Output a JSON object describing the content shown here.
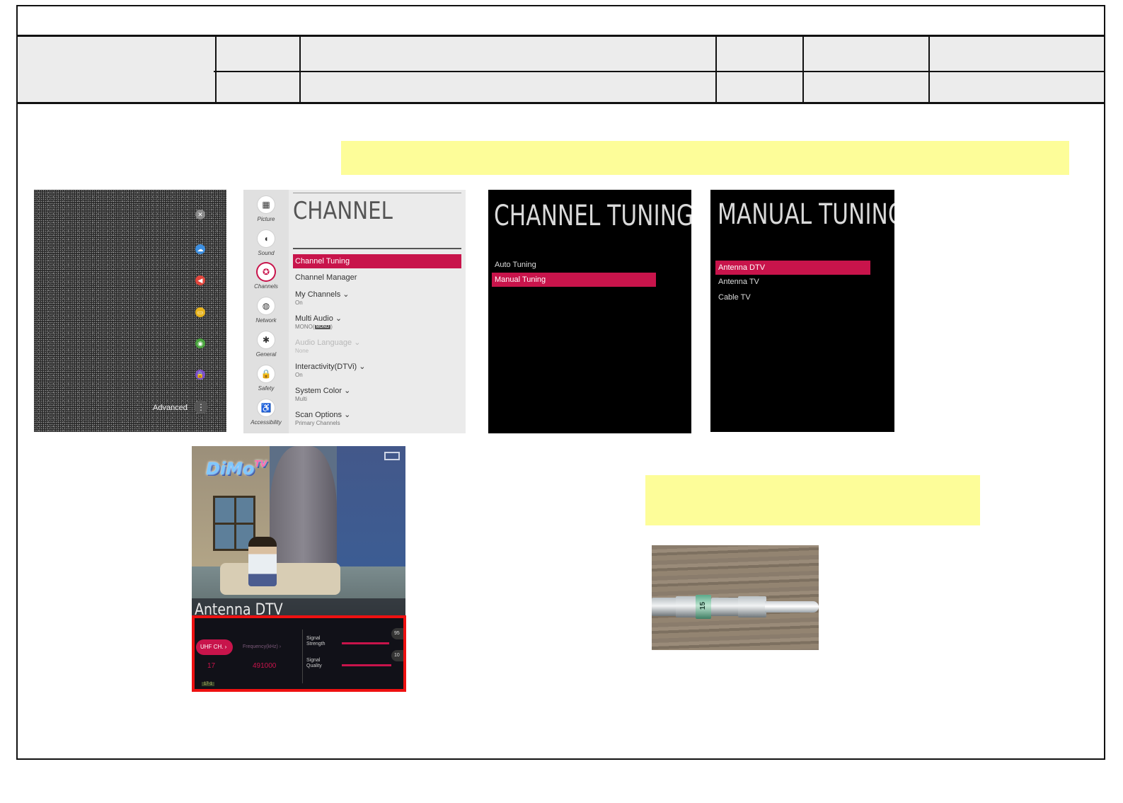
{
  "panels": {
    "quick_menu": {
      "advanced_label": "Advanced",
      "buttons": [
        {
          "icon": "close-icon",
          "glyph": "✕",
          "bg": "#8a8a8a"
        },
        {
          "icon": "picture-icon",
          "glyph": "☁",
          "bg": "#3d8fe0"
        },
        {
          "icon": "sound-icon",
          "glyph": "◀",
          "bg": "#e0463d"
        },
        {
          "icon": "channels-icon",
          "glyph": "▭",
          "bg": "#e6b21c"
        },
        {
          "icon": "network-icon",
          "glyph": "◉",
          "bg": "#4aa33e"
        },
        {
          "icon": "safety-icon",
          "glyph": "🔒",
          "bg": "#7b4fc8"
        }
      ]
    },
    "channel_menu": {
      "title": "CHANNEL",
      "sidebar": [
        {
          "label": "Picture",
          "icon": "picture-icon",
          "glyph": "▦"
        },
        {
          "label": "Sound",
          "icon": "sound-icon",
          "glyph": "◖"
        },
        {
          "label": "Channels",
          "icon": "channels-icon",
          "glyph": "✪"
        },
        {
          "label": "Network",
          "icon": "network-icon",
          "glyph": "◍"
        },
        {
          "label": "General",
          "icon": "general-icon",
          "glyph": "✱"
        },
        {
          "label": "Safety",
          "icon": "lock-icon",
          "glyph": "🔒"
        },
        {
          "label": "Accessibility",
          "icon": "accessibility-icon",
          "glyph": "♿"
        }
      ],
      "items": [
        {
          "label": "Channel Tuning",
          "sub": "",
          "state": "active"
        },
        {
          "label": "Channel Manager",
          "sub": "",
          "state": "normal"
        },
        {
          "label": "My Channels ⌄",
          "sub": "On",
          "state": "normal"
        },
        {
          "label": "Multi Audio ⌄",
          "sub": "MONO(",
          "tag": "MONO",
          "sub_end": ")",
          "state": "normal"
        },
        {
          "label": "Audio Language ⌄",
          "sub": "None",
          "state": "dim"
        },
        {
          "label": "Interactivity(DTVi) ⌄",
          "sub": "On",
          "state": "normal"
        },
        {
          "label": "System Color ⌄",
          "sub": "Multi",
          "state": "normal"
        },
        {
          "label": "Scan Options ⌄",
          "sub": "Primary Channels",
          "state": "normal"
        }
      ]
    },
    "channel_tuning": {
      "title": "CHANNEL TUNING",
      "items": [
        {
          "label": "Auto Tuning",
          "active": false
        },
        {
          "label": "Manual Tuning",
          "active": true
        }
      ]
    },
    "manual_tuning": {
      "title": "MANUAL TUNING",
      "items": [
        {
          "label": "Antenna DTV",
          "active": true
        },
        {
          "label": "Antenna TV",
          "active": false
        },
        {
          "label": "Cable TV",
          "active": false
        }
      ]
    },
    "tv_capture": {
      "logo": "DiMo",
      "logo_suffix": "TV",
      "banner_title": "Antenna DTV",
      "uhf_label": "UHF CH.  ›",
      "frequency_label": "Frequency(kHz)  ›",
      "channel": "17",
      "frequency": "491000",
      "signal_strength_label": "Signal\nStrength",
      "signal_quality_label": "Signal\nQuality",
      "signal_strength_value": "95",
      "signal_quality_value": "10",
      "signal_strength": 0.95,
      "signal_quality": 1.0,
      "tag": "17-1"
    },
    "cable_photo": {
      "fitting_label": "15"
    }
  },
  "colors": {
    "accent": "#c8144b",
    "highlight": "#fdfd99",
    "callout": "#ee1111"
  }
}
